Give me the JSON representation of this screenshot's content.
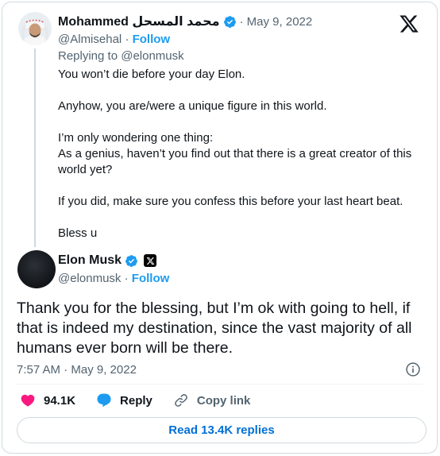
{
  "parent_tweet": {
    "display_name": "Mohammed محمد المسحل",
    "date": "· May 9, 2022",
    "handle": "@Almisehal",
    "separator": "·",
    "follow_label": "Follow",
    "replying_to": "Replying to @elonmusk",
    "paragraphs": [
      "You won’t die before your day Elon.",
      "Anyhow, you are/were a unique figure in this world.",
      "I’m only wondering one thing:",
      "As a genius, haven’t you find out that there is a great creator of this world yet?",
      "If you did, make sure you confess this before your last heart beat.",
      "Bless u"
    ]
  },
  "main_tweet": {
    "display_name": "Elon Musk",
    "handle": "@elonmusk",
    "separator": "·",
    "follow_label": "Follow",
    "text": "Thank you for the blessing, but I’m ok with going to hell, if that is indeed my destination, since the vast majority of all humans ever born will be there.",
    "timestamp": "7:57 AM · May 9, 2022"
  },
  "actions": {
    "likes": "94.1K",
    "reply_label": "Reply",
    "copy_link_label": "Copy link"
  },
  "read_replies_label": "Read 13.4K replies",
  "colors": {
    "accent": "#1d9bf0",
    "like": "#f91880",
    "muted": "#536471",
    "border": "#cfd9de"
  },
  "icons": [
    "verified-badge-icon",
    "x-logo-icon",
    "x-affiliate-badge-icon",
    "info-icon",
    "heart-icon",
    "reply-bubble-icon",
    "link-icon"
  ]
}
